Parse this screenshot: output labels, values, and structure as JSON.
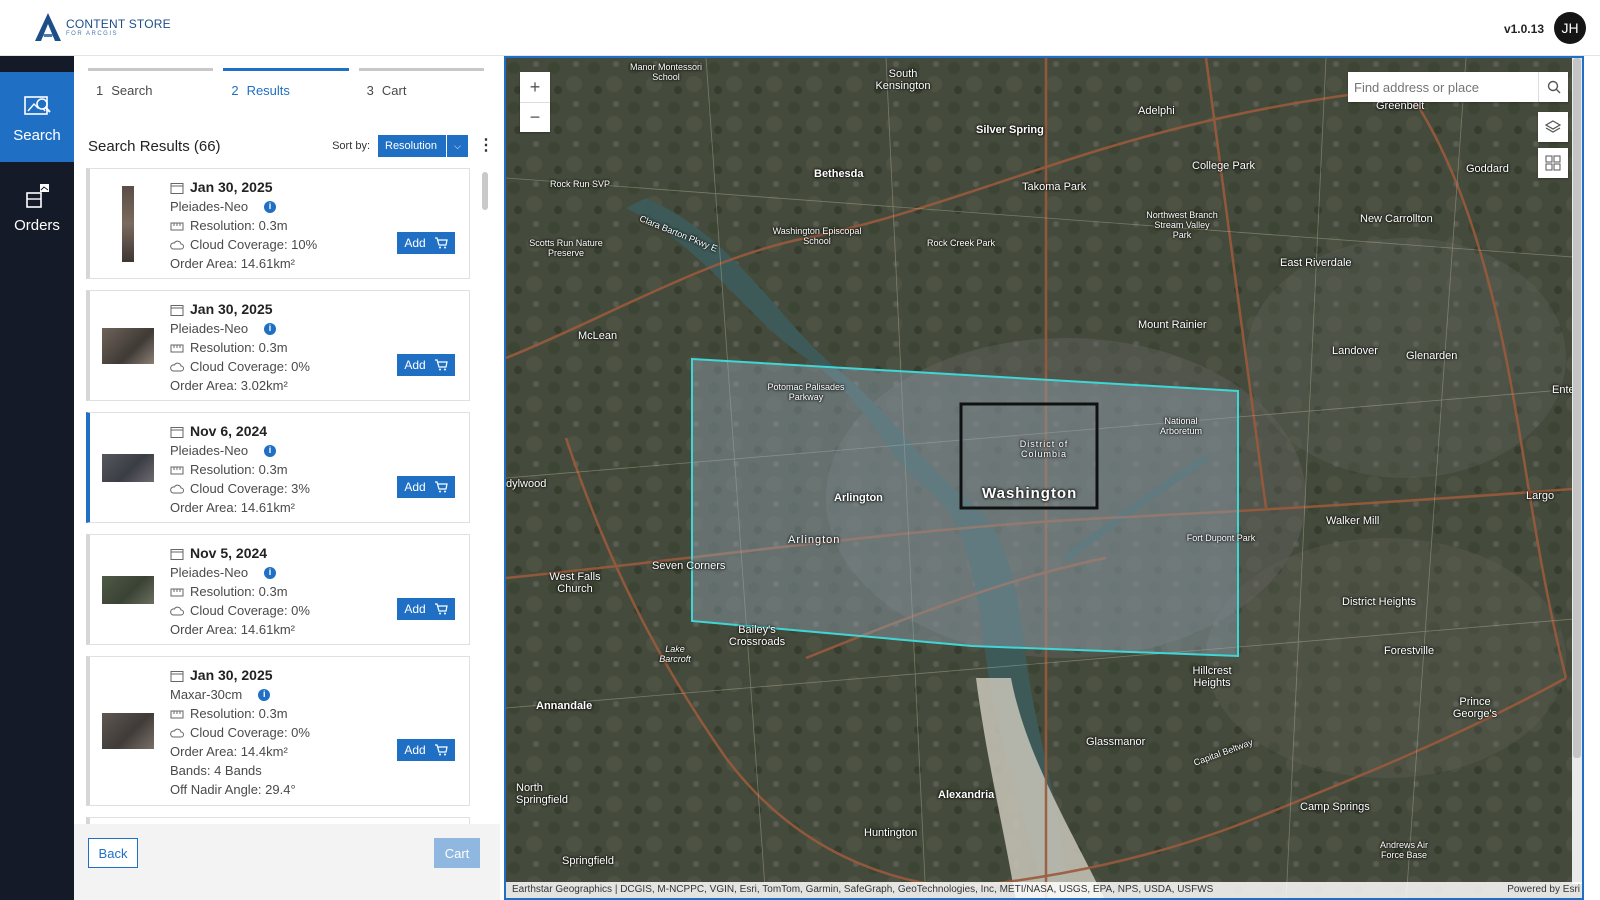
{
  "header": {
    "logo_title": "CONTENT STORE",
    "logo_sub": "FOR ARCGIS",
    "version": "v1.0.13",
    "avatar_initials": "JH"
  },
  "rail": {
    "items": [
      {
        "label": "Search",
        "icon": "search-imagery-icon",
        "active": true
      },
      {
        "label": "Orders",
        "icon": "orders-icon",
        "active": false
      }
    ]
  },
  "steps": [
    {
      "num": "1",
      "label": "Search"
    },
    {
      "num": "2",
      "label": "Results"
    },
    {
      "num": "3",
      "label": "Cart"
    }
  ],
  "results": {
    "title": "Search Results (66)",
    "sort_label": "Sort by:",
    "sort_value": "Resolution"
  },
  "cards": [
    {
      "date": "Jan 30, 2025",
      "sensor": "Pleiades-Neo",
      "resolution": "Resolution: 0.3m",
      "cloud": "Cloud Coverage: 10%",
      "area": "Order Area: 14.61km²",
      "add": "Add"
    },
    {
      "date": "Jan 30, 2025",
      "sensor": "Pleiades-Neo",
      "resolution": "Resolution: 0.3m",
      "cloud": "Cloud Coverage: 0%",
      "area": "Order Area: 3.02km²",
      "add": "Add"
    },
    {
      "date": "Nov 6, 2024",
      "sensor": "Pleiades-Neo",
      "resolution": "Resolution: 0.3m",
      "cloud": "Cloud Coverage: 3%",
      "area": "Order Area: 14.61km²",
      "add": "Add"
    },
    {
      "date": "Nov 5, 2024",
      "sensor": "Pleiades-Neo",
      "resolution": "Resolution: 0.3m",
      "cloud": "Cloud Coverage: 0%",
      "area": "Order Area: 14.61km²",
      "add": "Add"
    },
    {
      "date": "Jan 30, 2025",
      "sensor": "Maxar-30cm",
      "resolution": "Resolution: 0.3m",
      "cloud": "Cloud Coverage: 0%",
      "area": "Order Area: 14.4km²",
      "bands": "Bands: 4 Bands",
      "nadir": "Off Nadir Angle: 29.4°",
      "add": "Add"
    }
  ],
  "footer": {
    "back": "Back",
    "cart": "Cart"
  },
  "map": {
    "search_placeholder": "Find address or place",
    "zoom_in": "+",
    "zoom_out": "−",
    "attribution": "Earthstar Geographics | DCGIS, M-NCPPC, VGIN, Esri, TomTom, Garmin, SafeGraph, GeoTechnologies, Inc, METI/NASA, USGS, EPA, NPS, USDA, USFWS",
    "powered": "Powered by Esri",
    "labels": {
      "washington": "Washington",
      "dc": "District of Columbia",
      "arlington1": "Arlington",
      "arlington2": "Arlington",
      "silver_spring": "Silver Spring",
      "bethesda": "Bethesda",
      "takoma": "Takoma Park",
      "college_park": "College Park",
      "mclean": "McLean",
      "mount_rainier": "Mount Rainier",
      "alexandria": "Alexandria",
      "annandale": "Annandale",
      "seven_corners": "Seven Corners",
      "walker_mill": "Walker Mill",
      "district_heights": "District Heights",
      "landover": "Landover",
      "glenarden": "Glenarden",
      "new_carrollton": "New Carrollton",
      "east_riverdale": "East Riverdale",
      "south_kensington": "South Kensington",
      "adelphi": "Adelphi",
      "greenbelt": "Greenbelt",
      "goddard": "Goddard",
      "glassmanor": "Glassmanor",
      "forestville": "Forestville",
      "camp_springs": "Camp Springs",
      "huntington": "Huntington",
      "springfield": "Springfield",
      "north_springfield": "North Springfield",
      "baileys": "Bailey's Crossroads",
      "west_falls": "West Falls Church",
      "hillcrest": "Hillcrest Heights",
      "largo": "Largo",
      "prince_georges": "Prince George's",
      "rock_creek": "Rock Creek Park",
      "potomac_palisades": "Potomac Palisades Parkway",
      "national_arboretum": "National Arboretum",
      "fort_dupont": "Fort Dupont Park",
      "lake_barcroft": "Lake Barcroft",
      "rock_run": "Rock Run SVP",
      "scotts_run": "Scotts Run Nature Preserve",
      "clara_barton": "Clara Barton Pkwy E",
      "wash_episcopal": "Washington Episcopal School",
      "manor_montessori": "Manor Montessori School",
      "northwest_branch": "Northwest Branch Stream Valley Park",
      "dylwood": "dylwood",
      "enterp": "Enterp",
      "capital_beltway": "Capital Beltway",
      "andrews": "Andrews Air Force Base"
    }
  }
}
